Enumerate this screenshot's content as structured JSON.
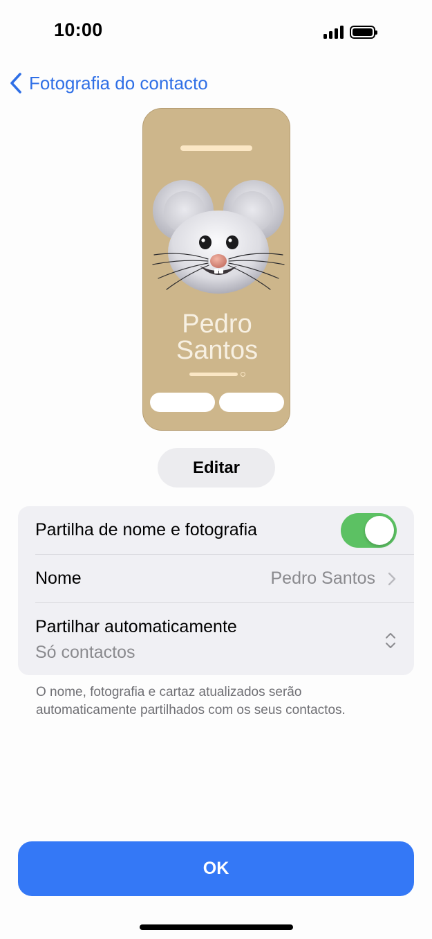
{
  "status_bar": {
    "time": "10:00",
    "signal_icon": "cellular-signal-icon",
    "battery_icon": "battery-full-icon"
  },
  "nav": {
    "back_icon": "chevron-left-icon",
    "back_label": "Fotografia do contacto"
  },
  "poster": {
    "first_name": "Pedro",
    "last_name": "Santos",
    "avatar": "memoji-mouse",
    "background_color": "#cdb68b"
  },
  "edit_button": {
    "label": "Editar"
  },
  "settings": {
    "share_toggle": {
      "label": "Partilha de nome e fotografia",
      "state": "on"
    },
    "name_row": {
      "label": "Nome",
      "value": "Pedro Santos",
      "icon": "chevron-right-icon"
    },
    "auto_share_row": {
      "label": "Partilhar automaticamente",
      "value": "Só contactos",
      "icon": "chevron-up-down-icon"
    }
  },
  "footnote": "O nome, fotografia e cartaz atualizados serão automaticamente partilhados com os seus contactos.",
  "ok_button": {
    "label": "OK"
  },
  "colors": {
    "accent": "#3478f6",
    "link": "#2f6fe6",
    "toggle_on": "#5cc163"
  }
}
